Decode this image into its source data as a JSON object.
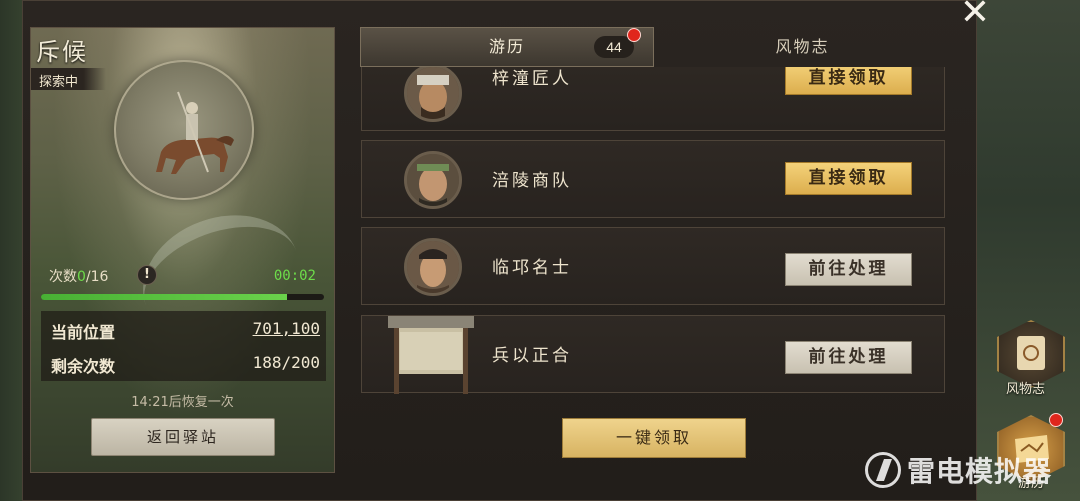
{
  "left_panel": {
    "title": "斥候",
    "status": "探索中",
    "attempts_label": "次数",
    "attempts_used": "0",
    "attempts_total": "/16",
    "alert_icon": "!",
    "timer": "00:02",
    "progress_fraction": 0.87,
    "position_label": "当前位置",
    "position_value": "701,100",
    "remaining_label": "剩余次数",
    "remaining_value": "188/200",
    "recover_text": "14:21后恢复一次",
    "return_button": "返回驿站"
  },
  "tabs": {
    "active_label": "游历",
    "active_count": "44",
    "inactive_label": "风物志"
  },
  "events": [
    {
      "name": "梓潼匠人",
      "action": "直接领取",
      "style": "gold",
      "icon": "craftsman-portrait"
    },
    {
      "name": "涪陵商队",
      "action": "直接领取",
      "style": "gold",
      "icon": "merchant-portrait"
    },
    {
      "name": "临邛名士",
      "action": "前往处理",
      "style": "grey",
      "icon": "scholar-portrait"
    },
    {
      "name": "兵以正合",
      "action": "前往处理",
      "style": "grey",
      "icon": "notice-board"
    }
  ],
  "claim_all_button": "一键领取",
  "close_icon": "close-icon",
  "side_buttons": {
    "gazetteer_label": "风物志",
    "travel_label": "游历"
  },
  "watermark": "雷电模拟器",
  "colors": {
    "accent_gold": "#dcae4e",
    "progress_green": "#6ad24b",
    "alert_red": "#e0261c"
  }
}
